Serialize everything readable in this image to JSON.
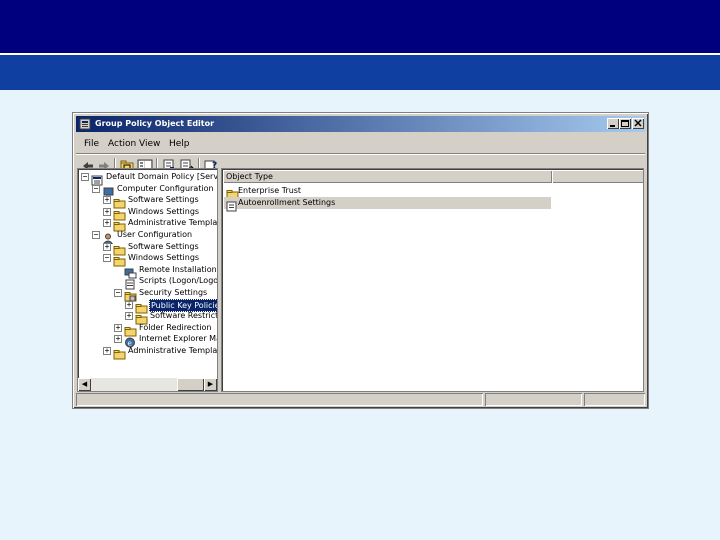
{
  "window": {
    "title": "Group Policy Object Editor"
  },
  "menu": [
    "File",
    "Action",
    "View",
    "Help"
  ],
  "toolbar_icons": [
    "back-arrow-icon",
    "forward-arrow-icon",
    "up-folder-icon",
    "show-tree-icon",
    "properties-icon",
    "export-list-icon",
    "help-icon"
  ],
  "tree": [
    {
      "label": "Default Domain Policy [Server-Acco",
      "expander": "minus",
      "icon": "policy-icon"
    },
    {
      "label": "Computer Configuration",
      "expander": "minus",
      "icon": "computer-icon"
    },
    {
      "label": "Software Settings",
      "expander": "plus",
      "icon": "folder-icon"
    },
    {
      "label": "Windows Settings",
      "expander": "plus",
      "icon": "folder-icon"
    },
    {
      "label": "Administrative Templates",
      "expander": "plus",
      "icon": "folder-icon"
    },
    {
      "label": "User Configuration",
      "expander": "minus",
      "icon": "user-icon"
    },
    {
      "label": "Software Settings",
      "expander": "plus",
      "icon": "folder-icon"
    },
    {
      "label": "Windows Settings",
      "expander": "minus",
      "icon": "folder-icon"
    },
    {
      "label": "Remote Installation Ser",
      "expander": "",
      "icon": "remote-install-icon"
    },
    {
      "label": "Scripts (Logon/Logoff)",
      "expander": "",
      "icon": "scripts-icon"
    },
    {
      "label": "Security Settings",
      "expander": "minus",
      "icon": "security-icon"
    },
    {
      "label": "Public Key Policies",
      "expander": "plus",
      "icon": "folder-icon",
      "selected": true
    },
    {
      "label": "Software Restriction Po",
      "expander": "plus",
      "icon": "folder-icon"
    },
    {
      "label": "Folder Redirection",
      "expander": "plus",
      "icon": "folder-icon"
    },
    {
      "label": "Internet Explorer Maint",
      "expander": "plus",
      "icon": "ie-icon"
    },
    {
      "label": "Administrative Templates",
      "expander": "plus",
      "icon": "folder-icon"
    }
  ],
  "list": {
    "column_header": "Object Type",
    "items": [
      {
        "label": "Enterprise Trust",
        "icon": "folder-icon"
      },
      {
        "label": "Autoenrollment Settings",
        "icon": "settings-doc-icon",
        "highlighted": true
      }
    ]
  },
  "colors": {
    "slide_header": "#00007f",
    "slide_band": "#0f3fa0",
    "slide_background": "#e8f4fc",
    "title_bar_start": "#0a246a",
    "title_bar_end": "#a6caf0",
    "window_face": "#d4d0c8",
    "selection": "#0a246a",
    "folder": "#f4d46c"
  }
}
